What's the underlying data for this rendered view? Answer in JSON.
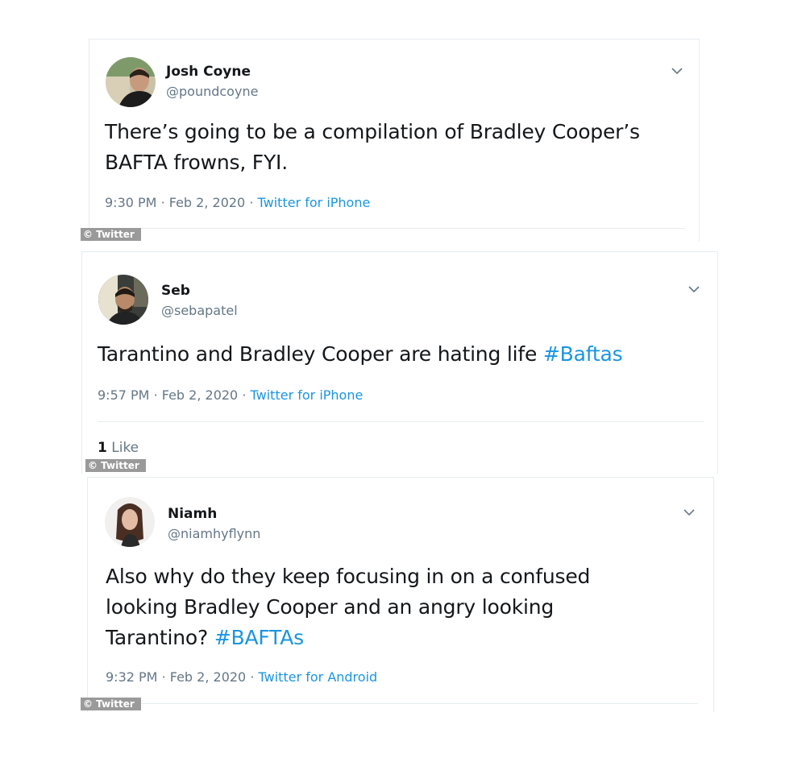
{
  "tweets": [
    {
      "display_name": "Josh Coyne",
      "handle": "@poundcoyne",
      "text": "There’s going to be a compilation of Bradley Cooper’s BAFTA frowns, FYI.",
      "time": "9:30 PM",
      "date": "Feb 2, 2020",
      "source": "Twitter for iPhone",
      "credit": "© Twitter"
    },
    {
      "display_name": "Seb",
      "handle": "@sebapatel",
      "text": "Tarantino and Bradley Cooper are hating life ",
      "hashtag": "#Baftas",
      "time": "9:57 PM",
      "date": "Feb 2, 2020",
      "source": "Twitter for iPhone",
      "like_count": "1",
      "like_label": "Like",
      "credit": "© Twitter"
    },
    {
      "display_name": "Niamh",
      "handle": "@niamhyflynn",
      "text": "Also why do they keep focusing in on a confused looking Bradley Cooper and an angry looking Tarantino? ",
      "hashtag": "#BAFTAs",
      "time": "9:32 PM",
      "date": "Feb 2, 2020",
      "source": "Twitter for Android",
      "credit": "© Twitter"
    }
  ],
  "colors": {
    "text": "#14171a",
    "secondary": "#657786",
    "link": "#1b95e0",
    "divider": "#e6ecf0",
    "credit_bg": "#9a9a9a"
  },
  "icons": {
    "caret": "chevron-down-icon"
  }
}
